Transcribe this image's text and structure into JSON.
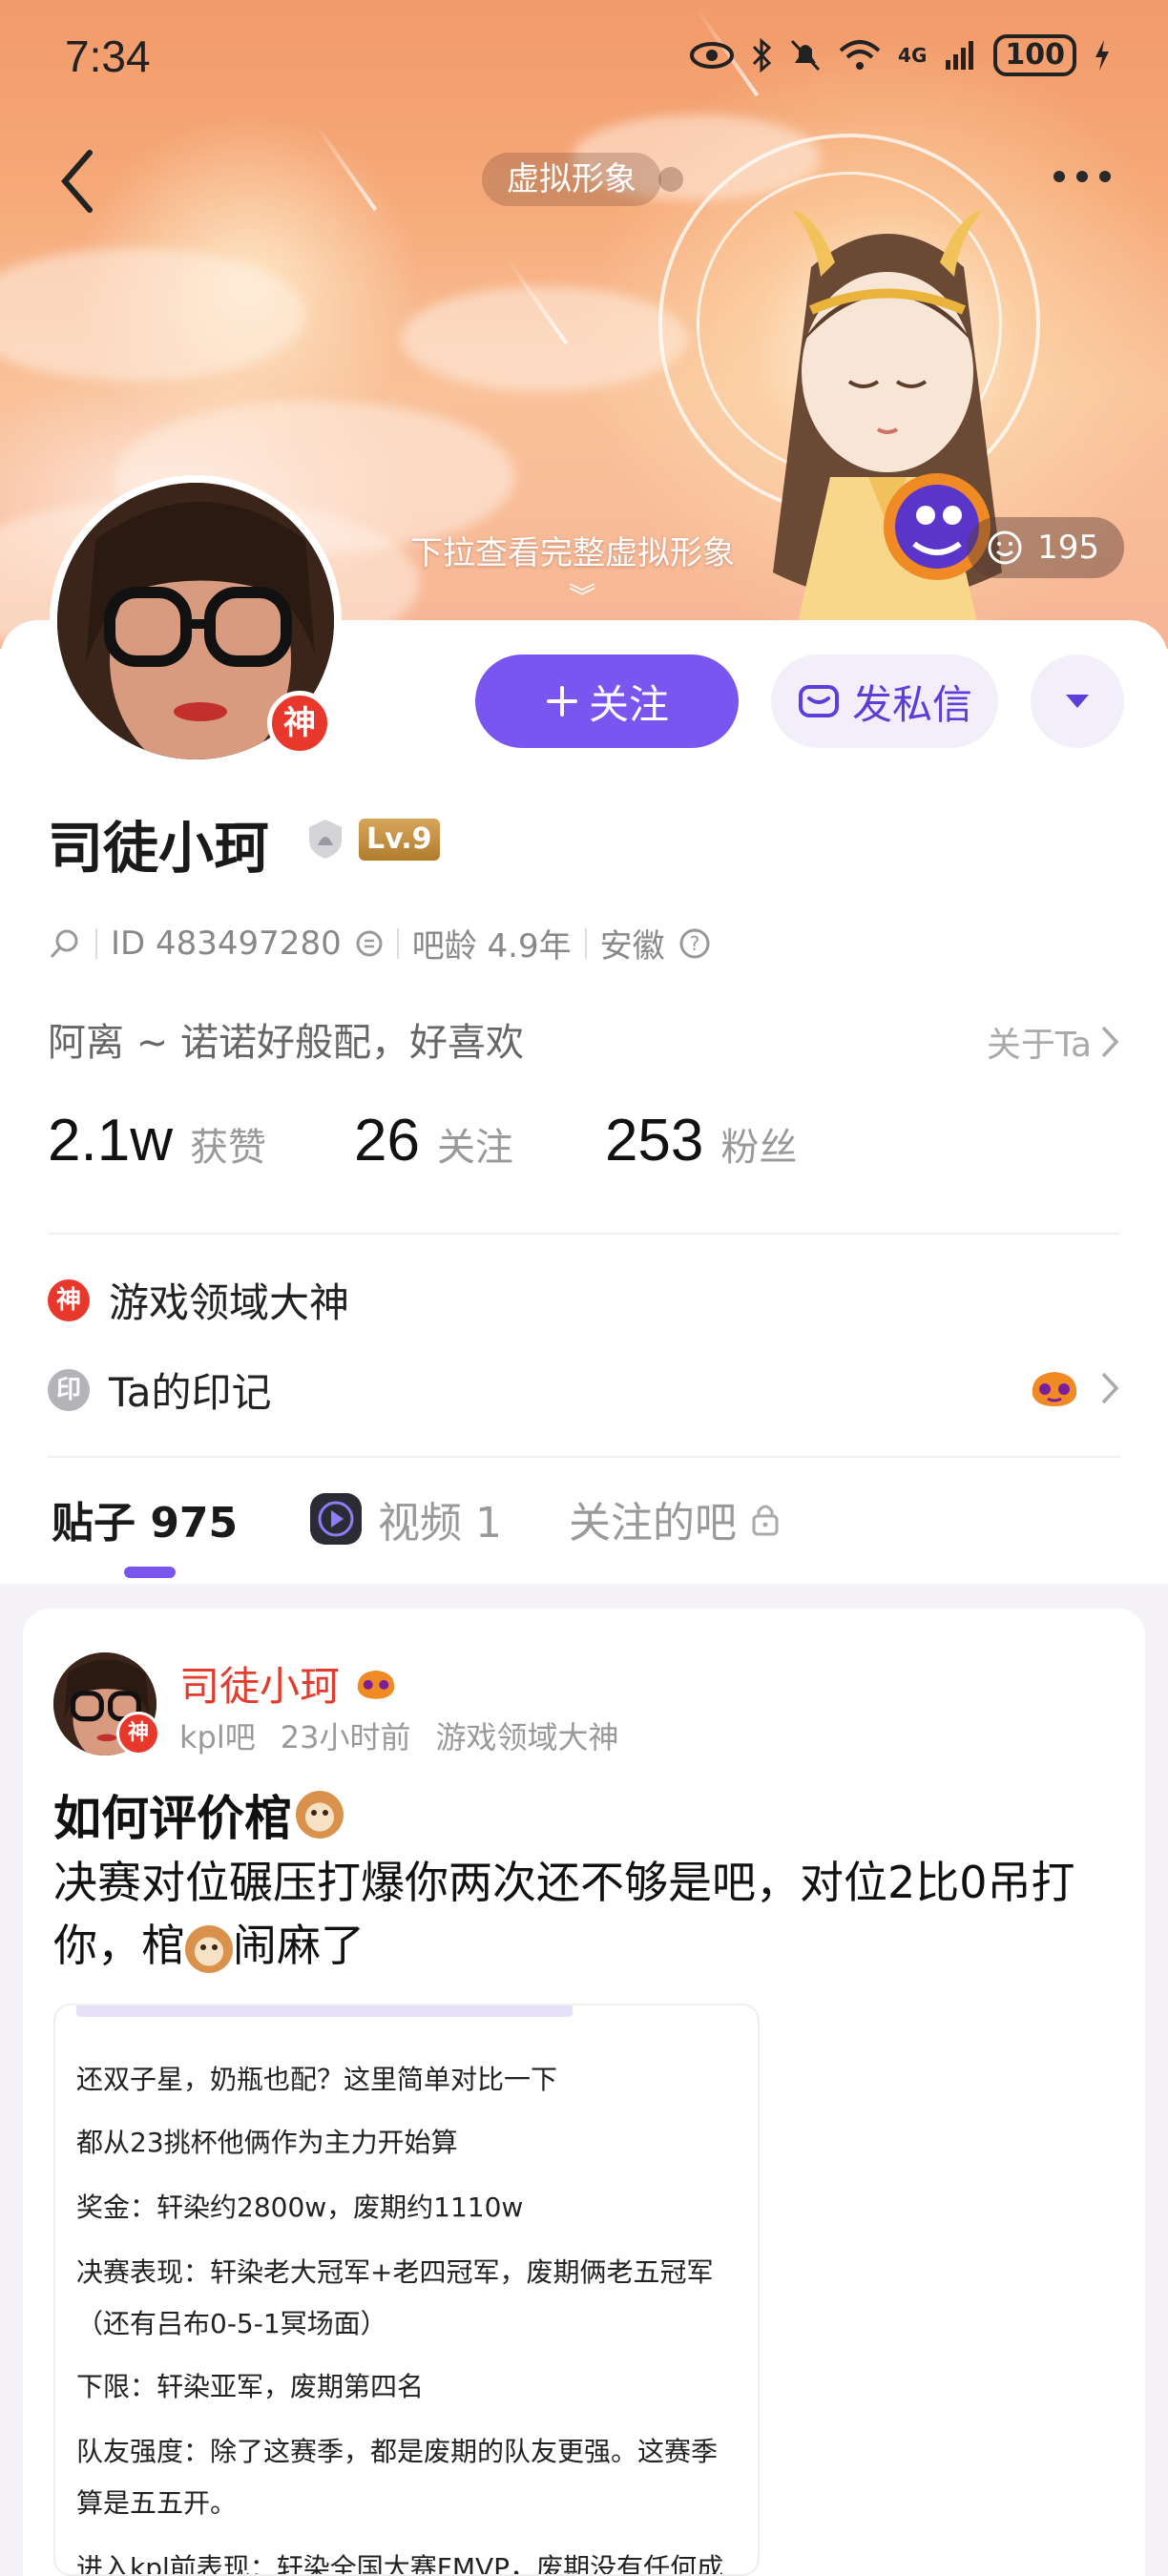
{
  "status_bar": {
    "time": "7:34",
    "battery": "100",
    "network": "4G"
  },
  "header": {
    "avatar_pill": "虚拟形象",
    "pull_hint": "下拉查看完整虚拟形象",
    "like_count": "195"
  },
  "profile": {
    "name": "司徒小珂",
    "level": "Lv.9",
    "badge_god": "神",
    "id_text": "ID 483497280",
    "tieba_age": "吧龄 4.9年",
    "location": "安徽",
    "bio": "阿离 ~ 诺诺好般配，好喜欢",
    "about_link": "关于Ta",
    "actions": {
      "follow": "关注",
      "message": "发私信"
    },
    "stats": [
      {
        "value": "2.1w",
        "label": "获赞"
      },
      {
        "value": "26",
        "label": "关注"
      },
      {
        "value": "253",
        "label": "粉丝"
      }
    ],
    "honors": [
      {
        "icon": "神",
        "label": "游戏领域大神",
        "color": "#e8382c"
      },
      {
        "icon": "印",
        "label": "Ta的印记",
        "color": "#b3b3b8"
      }
    ]
  },
  "tabs": [
    {
      "label": "贴子 975",
      "active": true
    },
    {
      "label": "视频 1",
      "active": false
    },
    {
      "label": "关注的吧",
      "active": false
    }
  ],
  "post": {
    "author": "司徒小珂",
    "forum": "kpl吧",
    "time": "23小时前",
    "tag": "游戏领域大神",
    "title": "如何评价棺",
    "body_part1": "决赛对位碾压打爆你两次还不够是吧，对位2比0吊打你，棺",
    "body_part2": "闹麻了",
    "image_lines": [
      "还双子星，奶瓶也配？这里简单对比一下",
      "都从23挑杯他俩作为主力开始算",
      "奖金：轩染约2800w，废期约1110w",
      "决赛表现：轩染老大冠军+老四冠军，废期俩老五冠军",
      "（还有吕布0-5-1冥场面）",
      "下限：轩染亚军，废期第四名",
      "队友强度：除了这赛季，都是废期的队友更强。这赛季",
      "算是五五开。",
      "进入kpl前表现：轩染全国大赛FMVP，废期没有任何成"
    ]
  },
  "colors": {
    "accent": "#7a55f0",
    "author_red": "#e33b2e"
  }
}
